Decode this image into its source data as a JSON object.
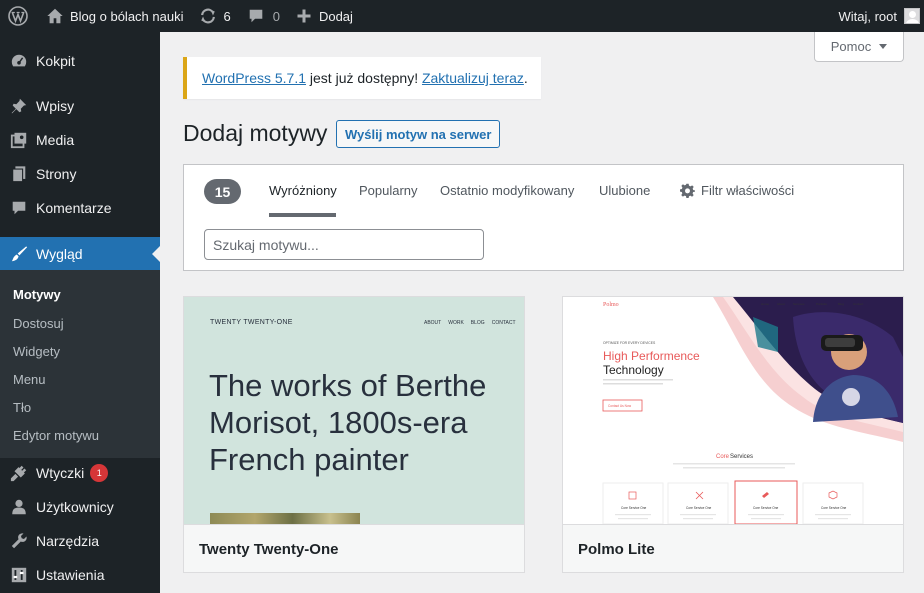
{
  "adminbar": {
    "site_name": "Blog o bólach nauki",
    "updates_count": "6",
    "comments_count": "0",
    "new_label": "Dodaj",
    "greeting": "Witaj, root"
  },
  "sidebar": {
    "items": [
      {
        "label": "Kokpit",
        "icon": "dashboard-icon"
      },
      {
        "label": "Wpisy",
        "icon": "pushpin-icon"
      },
      {
        "label": "Media",
        "icon": "media-icon"
      },
      {
        "label": "Strony",
        "icon": "pages-icon"
      },
      {
        "label": "Komentarze",
        "icon": "comments-icon"
      },
      {
        "label": "Wygląd",
        "icon": "paintbrush-icon",
        "active": true
      },
      {
        "label": "Wtyczki",
        "icon": "plugins-icon",
        "badge": "1"
      },
      {
        "label": "Użytkownicy",
        "icon": "users-icon"
      },
      {
        "label": "Narzędzia",
        "icon": "tools-icon"
      },
      {
        "label": "Ustawienia",
        "icon": "settings-icon"
      }
    ],
    "submenu": [
      "Motywy",
      "Dostosuj",
      "Widgety",
      "Menu",
      "Tło",
      "Edytor motywu"
    ]
  },
  "help": {
    "label": "Pomoc"
  },
  "notice": {
    "version_link": "WordPress 5.7.1",
    "text": " jest już dostępny! ",
    "update_link": "Zaktualizuj teraz",
    "period": "."
  },
  "page": {
    "title": "Dodaj motywy",
    "upload_button": "Wyślij motyw na serwer"
  },
  "filter": {
    "count": "15",
    "tabs": [
      "Wyróżniony",
      "Popularny",
      "Ostatnio modyfikowany",
      "Ulubione"
    ],
    "feature_filter": "Filtr właściwości",
    "search_placeholder": "Szukaj motywu..."
  },
  "themes": [
    {
      "name": "Twenty Twenty-One",
      "preview": {
        "site_title": "TWENTY TWENTY-ONE",
        "nav": [
          "ABOUT",
          "WORK",
          "BLOG",
          "CONTACT"
        ],
        "headline": "The works of Berthe Morisot, 1800s-era French painter"
      }
    },
    {
      "name": "Polmo Lite",
      "preview": {
        "logo": "Polmo",
        "nav": [
          "Home",
          "About",
          "Services",
          "Portfolio",
          "Blog",
          "Contact"
        ],
        "tagline": "OPTIMIZE FOR EVERY DEVICES",
        "headline_1": "High Performence",
        "headline_2": "Technology",
        "button": "Contact Us Now",
        "section_title_1": "Core",
        "section_title_2": "Services",
        "service_label": "Core Service One"
      }
    }
  ],
  "colors": {
    "admin_dark": "#1d2327",
    "accent": "#2271b1",
    "notice_warning": "#dba617",
    "badge": "#d63638"
  }
}
